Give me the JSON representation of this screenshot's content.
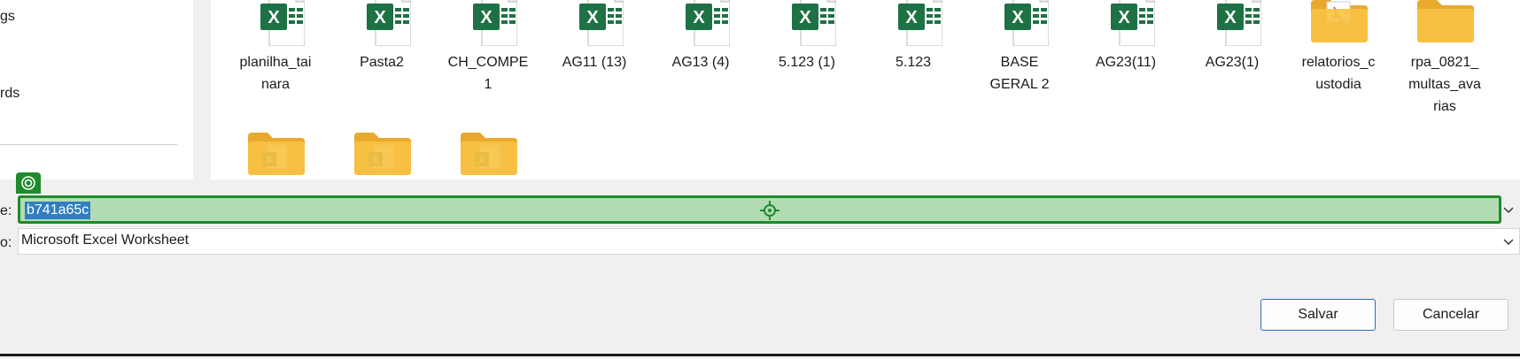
{
  "nav": {
    "items": [
      "gs",
      "rds"
    ]
  },
  "files": [
    {
      "label": "planilha_tai\nnara",
      "icon": "excel-file-icon"
    },
    {
      "label": "Pasta2",
      "icon": "excel-file-icon"
    },
    {
      "label": "CH_COMPE\n1",
      "icon": "excel-file-icon"
    },
    {
      "label": "AG11 (13)",
      "icon": "excel-file-icon"
    },
    {
      "label": "AG13 (4)",
      "icon": "excel-file-icon"
    },
    {
      "label": "5.123 (1)",
      "icon": "excel-file-icon"
    },
    {
      "label": "5.123",
      "icon": "excel-file-icon"
    },
    {
      "label": "BASE\nGERAL 2",
      "icon": "excel-file-icon"
    },
    {
      "label": "AG23(11)",
      "icon": "excel-file-icon"
    },
    {
      "label": "AG23(1)",
      "icon": "excel-file-icon"
    },
    {
      "label": "relatorios_c\nustodia",
      "icon": "pdf-folder-icon"
    },
    {
      "label": "rpa_0821_\nmultas_ava\nrias",
      "icon": "folder-icon"
    },
    {
      "label": "",
      "icon": "excel-folder-icon"
    },
    {
      "label": "",
      "icon": "excel-folder-icon"
    },
    {
      "label": "",
      "icon": "excel-folder-icon"
    }
  ],
  "form": {
    "name_label": "e:",
    "name_value": "b741a65c",
    "type_label": "o:",
    "type_value": "Microsoft Excel Worksheet"
  },
  "buttons": {
    "save": "Salvar",
    "cancel": "Cancelar"
  },
  "colors": {
    "excel_green": "#1e7145",
    "folder_yellow": "#f8c244",
    "highlight_green": "#1e8a2b",
    "selection_blue": "#2f7fc1",
    "accent_blue": "#2a6cc1"
  }
}
